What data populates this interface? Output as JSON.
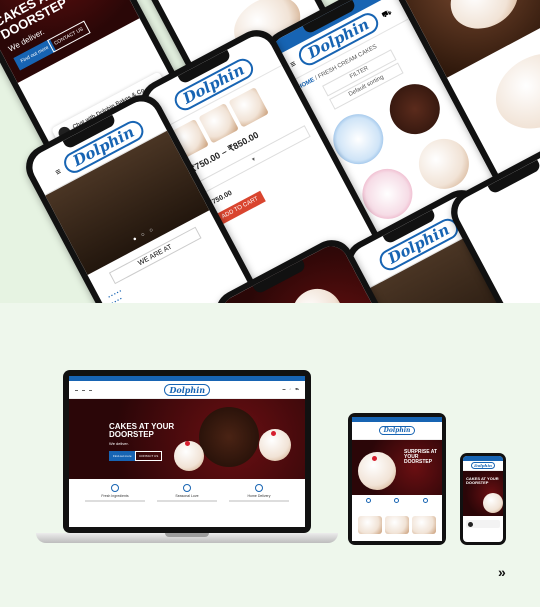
{
  "brand": {
    "logo": "Dolphin",
    "accent": "#1764b3",
    "cta": "#d9452f"
  },
  "hero": {
    "title_line1": "CAKES AT YOUR",
    "title_line2": "DOORSTEP",
    "subtitle": "We deliver.",
    "button_1": "Find out more",
    "button_2": "CONTACT US"
  },
  "chat": {
    "label": "Chat with Dolphin Bakes & Co."
  },
  "shop": {
    "breadcrumb_home": "HOME",
    "breadcrumb_sep": "/",
    "breadcrumb_current": "FRESH CREAM CAKES",
    "filter_label": "FILTER",
    "sort_label": "Default sorting",
    "product_price_1": "₹750.00",
    "product_price_2": "₹850.00",
    "add_to_cart": "ADD TO CART"
  },
  "contact": {
    "heading": "WE ARE AT"
  },
  "features": [
    {
      "title": "Fresh Ingredients"
    },
    {
      "title": "Seasonal Love"
    },
    {
      "title": "Home Delivery"
    }
  ],
  "tablet_hero": {
    "title_line1": "SURPRISE AT YOUR",
    "title_line2": "DOORSTEP"
  },
  "icons": [
    "chevron-right-icon",
    "messenger-icon",
    "home-icon",
    "search-icon",
    "cart-icon",
    "user-icon"
  ]
}
